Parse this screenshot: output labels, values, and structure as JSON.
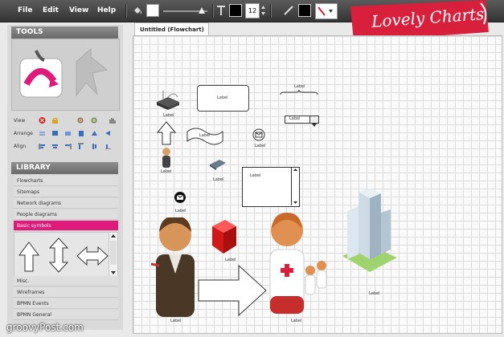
{
  "menu": {
    "items": [
      "File",
      "Edit",
      "View",
      "Help"
    ]
  },
  "toolbar": {
    "font_size": "12"
  },
  "brand": {
    "logo_text": "Lovely Charts"
  },
  "tools": {
    "title": "TOOLS",
    "rows": {
      "view": "View",
      "arrange": "Arrange",
      "align": "Align"
    }
  },
  "library": {
    "title": "LIBRARY",
    "items": [
      "Flowcharts",
      "Sitemaps",
      "Network diagrams",
      "People diagrams",
      "Basic symbols",
      "Misc.",
      "Wireframes",
      "BPMN Events",
      "BPMN General"
    ],
    "selected": "Basic symbols"
  },
  "document": {
    "tab_title": "Untitled (Flowchart)"
  },
  "canvas": {
    "shape_label": "Label"
  },
  "watermark": {
    "text": "groovyPost.com"
  },
  "colors": {
    "accent": "#e0197a",
    "logo_red": "#d81f3c",
    "toolbar": "#3f3f3f"
  }
}
